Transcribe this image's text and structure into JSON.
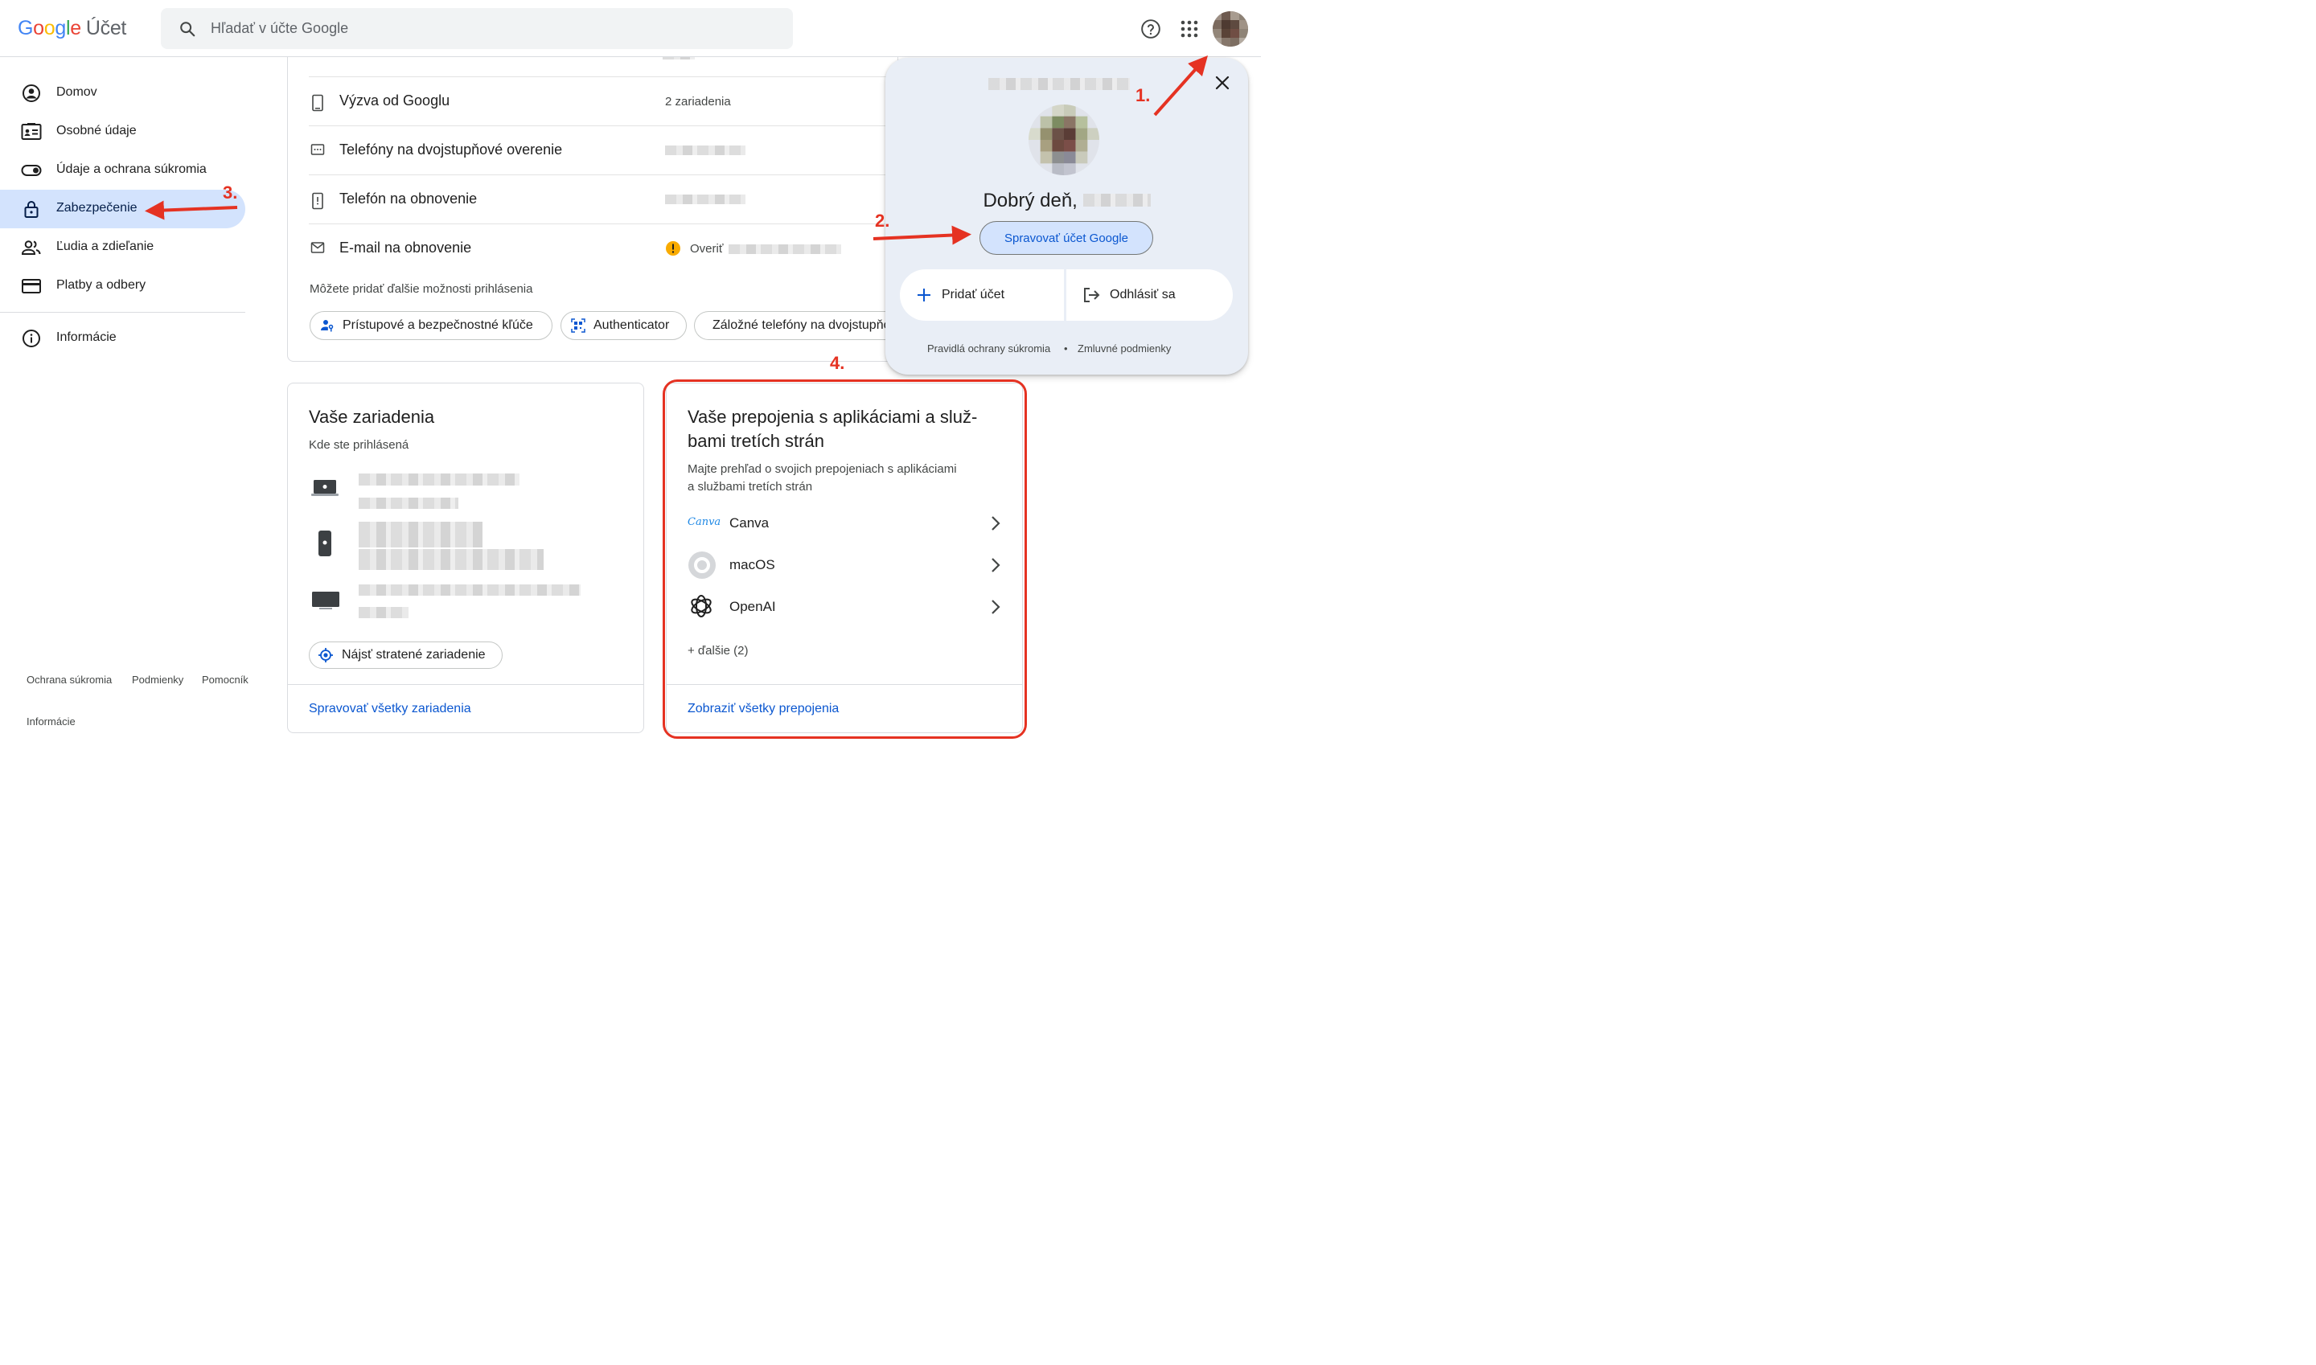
{
  "header": {
    "logo": {
      "g": "G",
      "o1": "o",
      "o2": "o",
      "g2": "g",
      "l": "l",
      "e": "e",
      "product": "Účet"
    },
    "search_placeholder": "Hľadať v účte Google"
  },
  "sidebar": {
    "items": [
      {
        "label": "Domov"
      },
      {
        "label": "Osobné údaje"
      },
      {
        "label": "Údaje a ochrana súkromia"
      },
      {
        "label": "Zabezpečenie"
      },
      {
        "label": "Ľudia a zdieľanie"
      },
      {
        "label": "Platby a odbery"
      },
      {
        "label": "Informácie"
      }
    ],
    "footer": {
      "privacy": "Ochrana súkromia",
      "terms": "Podmienky",
      "help": "Pomocník",
      "about": "Informácie"
    }
  },
  "security": {
    "rows": [
      {
        "label": "Výzva od Googlu",
        "value": "2 zariadenia"
      },
      {
        "label": "Telefóny na dvojstupňové overenie",
        "value": ""
      },
      {
        "label": "Telefón na obnovenie",
        "value": ""
      },
      {
        "label": "E-mail na obnovenie",
        "value": "Overiť"
      }
    ],
    "hint": "Môžete pridať ďalšie možnosti prihlásenia",
    "chips": [
      {
        "label": "Prístupové a bezpečnostné kľúče"
      },
      {
        "label": "Authenticator"
      },
      {
        "label": "Záložné telefóny na dvojstupňové overenie"
      }
    ]
  },
  "devices": {
    "title": "Vaše zariadenia",
    "subtitle": "Kde ste prihlásená",
    "find_button": "Nájsť stratené zariadenie",
    "manage_link": "Spravovať všetky zariadenia"
  },
  "connections": {
    "title_line1": "Vaše prepojenia s aplikáciami a služ-",
    "title_line2": "bami tretích strán",
    "subtitle_line1": "Majte prehľad o svojich prepojeniach s aplikáciami",
    "subtitle_line2": "a službami tretích strán",
    "items": [
      {
        "name": "Canva",
        "logo_text": "Canva"
      },
      {
        "name": "macOS"
      },
      {
        "name": "OpenAI"
      }
    ],
    "more": "+ ďalšie (2)",
    "view_all": "Zobraziť všetky prepojenia"
  },
  "popup": {
    "greeting": "Dobrý deň,",
    "manage_button": "Spravovať účet Google",
    "add_account": "Pridať účet",
    "sign_out": "Odhlásiť sa",
    "privacy": "Pravidlá ochrany súkromia",
    "separator": "•",
    "terms": "Zmluvné podmienky"
  },
  "annotations": {
    "n1": "1.",
    "n2": "2.",
    "n3": "3.",
    "n4": "4."
  },
  "colors": {
    "accent": "#0b57d0",
    "active_nav": "#d3e3fd",
    "annotation": "#e53222",
    "warning": "#f9ab00"
  }
}
